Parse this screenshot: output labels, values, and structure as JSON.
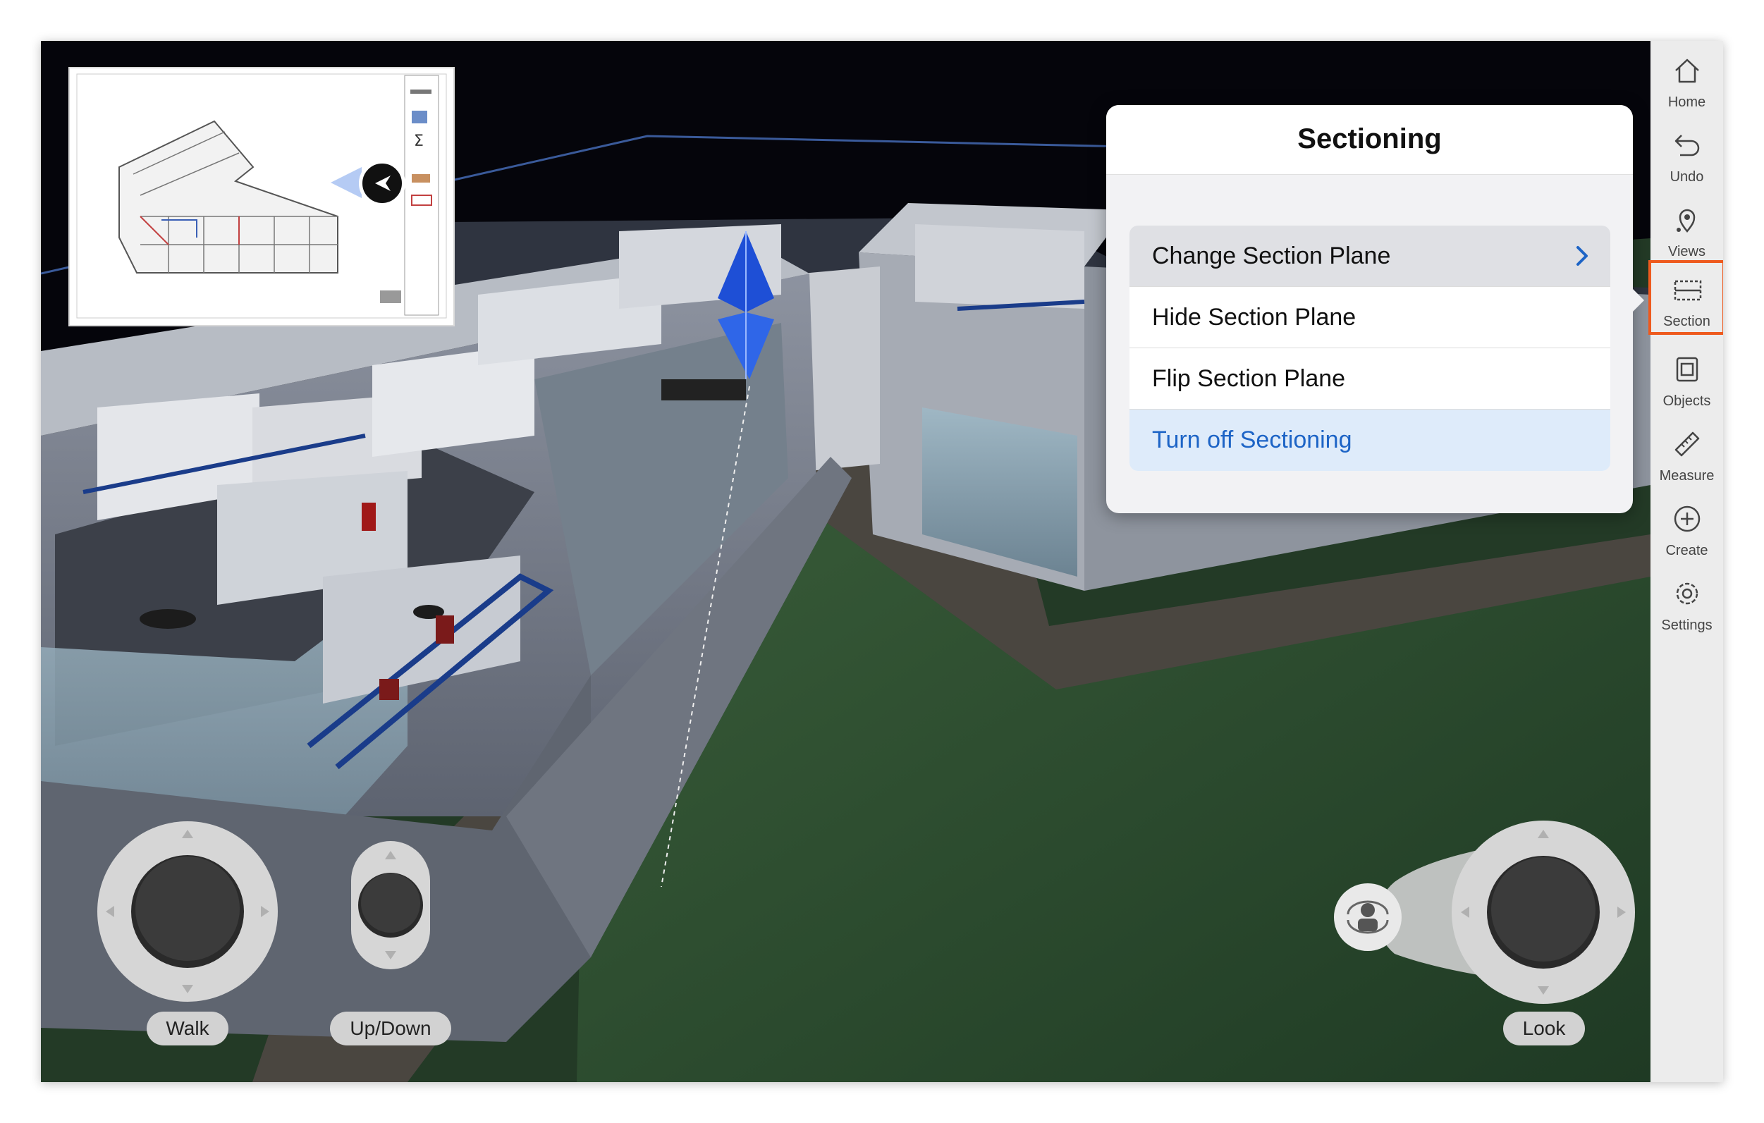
{
  "popover": {
    "title": "Sectioning",
    "items": [
      {
        "label": "Change Section Plane",
        "has_submenu": true
      },
      {
        "label": "Hide Section Plane"
      },
      {
        "label": "Flip Section Plane"
      },
      {
        "label": "Turn off Sectioning",
        "highlighted": true
      }
    ]
  },
  "sidebar": {
    "items": [
      {
        "label": "Home",
        "icon": "home-icon"
      },
      {
        "label": "Undo",
        "icon": "undo-icon"
      },
      {
        "label": "Views",
        "icon": "location-pin-icon"
      },
      {
        "label": "Section",
        "icon": "section-plane-icon",
        "selected": true
      },
      {
        "label": "Objects",
        "icon": "objects-icon"
      },
      {
        "label": "Measure",
        "icon": "ruler-icon"
      },
      {
        "label": "Create",
        "icon": "plus-circle-icon"
      },
      {
        "label": "Settings",
        "icon": "gear-icon"
      }
    ]
  },
  "controls": {
    "walk_label": "Walk",
    "updown_label": "Up/Down",
    "look_label": "Look",
    "orbit_icon": "orbit-person-icon"
  },
  "colors": {
    "selection_outline": "#ee5a1e",
    "link_blue": "#1d64c6",
    "ground_green": "#2c4a2e"
  }
}
